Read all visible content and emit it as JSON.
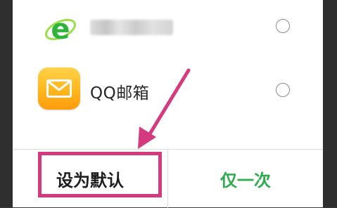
{
  "dialog": {
    "apps": [
      {
        "icon": "browser-e-icon",
        "name_blurred": true
      },
      {
        "icon": "qq-mail-icon",
        "name": "QQ邮箱"
      }
    ],
    "buttons": {
      "set_default": "设为默认",
      "once": "仅一次"
    }
  },
  "annotation": {
    "highlight_color": "#d63a7e",
    "arrow_color": "#d63a7e"
  },
  "colors": {
    "accent_green": "#2eab4c",
    "browser_icon_green": "#3cc24a",
    "mail_icon_orange": "#ffb61d"
  }
}
